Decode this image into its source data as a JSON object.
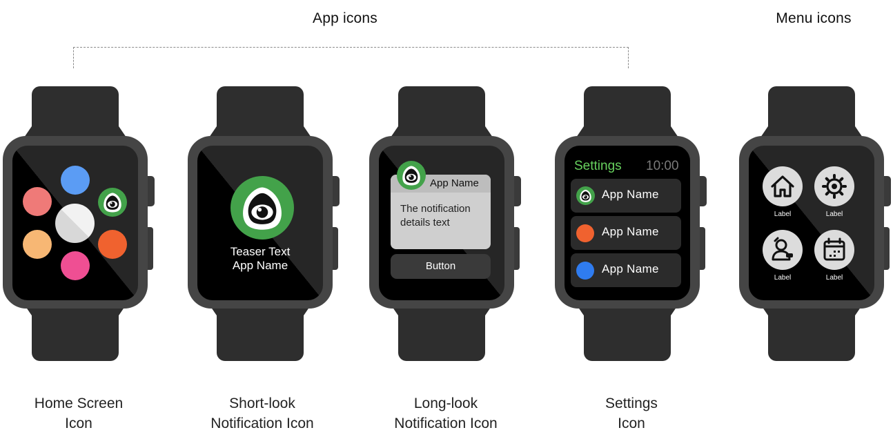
{
  "headings": {
    "app_icons": "App icons",
    "menu_icons": "Menu icons"
  },
  "watches": {
    "home": {
      "caption": [
        "Home Screen",
        "Icon"
      ],
      "dots": [
        "#5b9cf4",
        "#ef7a78",
        "#ececec",
        "#f7b774",
        "#f0622f",
        "#ef4f93"
      ],
      "app_icon": "eye-app-icon"
    },
    "short_look": {
      "caption": [
        "Short-look",
        "Notification Icon"
      ],
      "teaser": "Teaser Text",
      "app_name": "App Name",
      "app_icon": "eye-app-icon"
    },
    "long_look": {
      "caption": [
        "Long-look",
        "Notification Icon"
      ],
      "app_name": "App Name",
      "body": [
        "The notification",
        "details text"
      ],
      "button": "Button",
      "app_icon": "eye-app-icon"
    },
    "settings": {
      "caption": [
        "Settings",
        "Icon"
      ],
      "title": "Settings",
      "time": "10:00",
      "rows": [
        {
          "label": "App Name",
          "icon": "eye-app-icon"
        },
        {
          "label": "App Name",
          "color": "#f0622f"
        },
        {
          "label": "App Name",
          "color": "#2f7cf0"
        }
      ]
    },
    "menu": {
      "items": [
        {
          "label": "Label",
          "icon": "home-icon"
        },
        {
          "label": "Label",
          "icon": "gear-icon"
        },
        {
          "label": "Label",
          "icon": "user-icon"
        },
        {
          "label": "Label",
          "icon": "calendar-icon"
        }
      ]
    }
  },
  "colors": {
    "brand_green": "#43a24a",
    "settings_green": "#67d15e",
    "watch_body": "#454545",
    "band": "#2e2e2e"
  }
}
